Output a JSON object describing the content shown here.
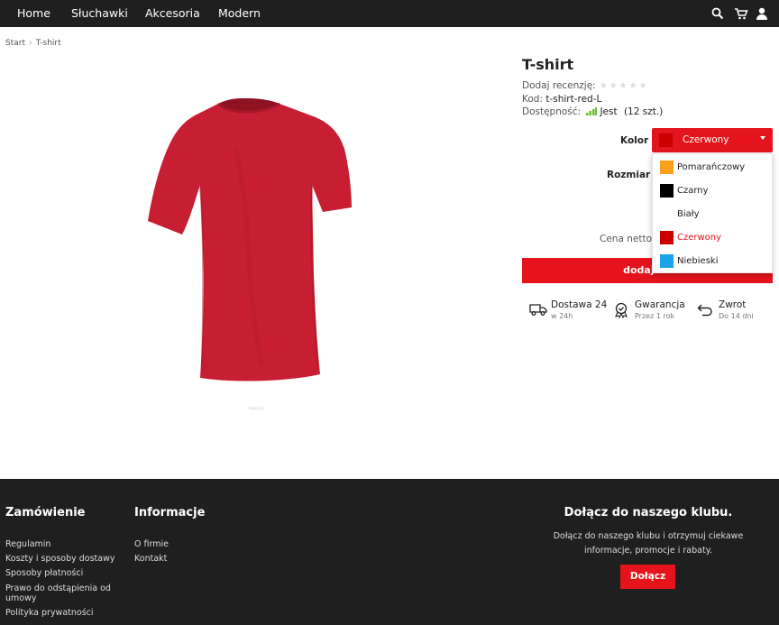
{
  "nav": {
    "items": [
      "Home",
      "Słuchawki",
      "Akcesoria",
      "Modern"
    ],
    "icons": [
      "search-icon",
      "cart-icon",
      "user-icon"
    ]
  },
  "breadcrumb": {
    "items": [
      "Start",
      "T-shirt"
    ]
  },
  "product": {
    "title": "T-shirt",
    "review_label": "Dodaj recenzję:",
    "rating": 0,
    "rating_max": 5,
    "code_label": "Kod:",
    "code_value": "t-shirt-red-L",
    "availability_label": "Dostępność:",
    "availability_value": "Jest",
    "availability_qty": "(12 szt.)",
    "image_caption": "Kopiuj.pl",
    "color_label": "Kolor",
    "size_label": "Rozmiar",
    "price_label": "Cena netto:",
    "selected_color": "Czerwony",
    "color_options": [
      {
        "name": "Pomarańczowy",
        "color": "#f9a11b"
      },
      {
        "name": "Czarny",
        "color": "#000000"
      },
      {
        "name": "Biały",
        "color": "#ffffff"
      },
      {
        "name": "Czerwony",
        "color": "#cc0000"
      },
      {
        "name": "Niebieski",
        "color": "#1aa3e8"
      }
    ],
    "add_button": "dodaj do",
    "perks": [
      {
        "icon": "truck-icon",
        "title": "Dostawa 24",
        "sub": "w 24h"
      },
      {
        "icon": "badge-icon",
        "title": "Gwarancja",
        "sub": "Przez 1 rok"
      },
      {
        "icon": "return-icon",
        "title": "Zwrot",
        "sub": "Do 14 dni"
      }
    ]
  },
  "colors": {
    "accent": "#e5141c",
    "dark": "#1f1f1f",
    "shirt": "#c81e32",
    "availability_green": "#6abf2d"
  },
  "footer": {
    "order_title": "Zamówienie",
    "order_links": [
      "Regulamin",
      "Koszty i sposoby dostawy",
      "Sposoby płatności",
      "Prawo do odstąpienia od umowy",
      "Polityka prywatności"
    ],
    "info_title": "Informacje",
    "info_links": [
      "O firmie",
      "Kontakt"
    ],
    "club_title": "Dołącz do naszego klubu.",
    "club_text": "Dołącz do naszego klubu i otrzymuj ciekawe informacje, promocje i rabaty.",
    "club_button": "Dołącz"
  }
}
